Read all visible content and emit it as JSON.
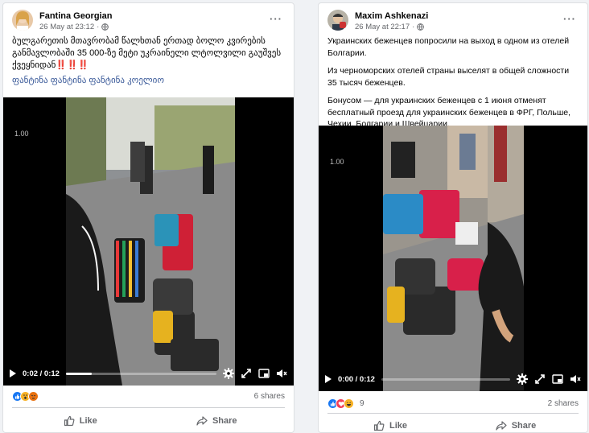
{
  "posts": [
    {
      "author": "Fantina Georgian",
      "time": "26 May at 23:12",
      "text": "ბულგარეთის მთავრობამ წალხთან ერთად ბოლო კვირების განმავლობაში 35 000-ზე მეტი უკრაინელი ლტოლვილი გაუშვეს ქვეყნიდან",
      "emoji": "‼️‼️‼️",
      "tags": "ფანტინა ფანტინა ფანტინა კოელიო",
      "video": {
        "version": "1.00",
        "time": "0:02 / 0:12",
        "progress": 0.17
      },
      "shares": "6 shares",
      "reaction_count": "",
      "like_label": "Like",
      "share_label": "Share"
    },
    {
      "author": "Maxim Ashkenazi",
      "time": "26 May at 22:17",
      "paragraphs": [
        "Украинских беженцев попросили на выход в одном из отелей Болгарии.",
        "Из черноморских отелей страны выселят в общей сложности 35 тысяч беженцев.",
        "Бонусом — для украинских беженцев с 1 июня отменят бесплатный проезд для украинских беженцев в ФРГ, Польше, Чехии, Болгарии и Швейцарии."
      ],
      "video": {
        "version": "1.00",
        "time": "0:00 / 0:12",
        "progress": 0.0
      },
      "reaction_count": "9",
      "shares": "2 shares",
      "like_label": "Like",
      "share_label": "Share"
    }
  ],
  "colors": {
    "like_blue": "#1877f2",
    "love_red": "#f33e58",
    "wow_yellow": "#f7b125",
    "link": "#385898"
  },
  "icons": [
    "globe-icon",
    "more-icon",
    "play-icon",
    "settings-icon",
    "fullscreen-icon",
    "pip-icon",
    "volume-icon",
    "like-icon",
    "share-icon"
  ]
}
